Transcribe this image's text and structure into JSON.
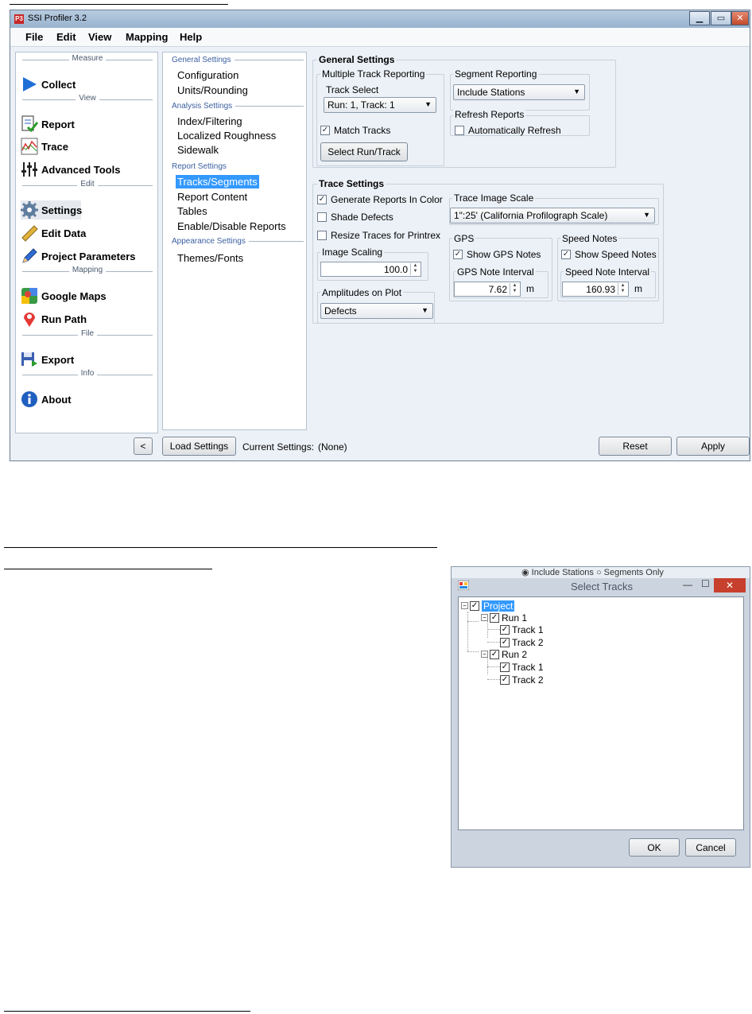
{
  "window": {
    "title": "SSI Profiler 3.2",
    "app_icon_text": "P3",
    "controls": {
      "minimize": "▁",
      "maximize": "▭",
      "close": "✕"
    }
  },
  "menu": [
    "File",
    "Edit",
    "View",
    "Mapping",
    "Help"
  ],
  "nav": {
    "sections": [
      "Measure",
      "View",
      "Edit",
      "Mapping",
      "File",
      "Info"
    ],
    "items": [
      "Collect",
      "Report",
      "Trace",
      "Advanced Tools",
      "Settings",
      "Edit Data",
      "Project Parameters",
      "Google Maps",
      "Run Path",
      "Export",
      "About"
    ]
  },
  "settings_list": {
    "sections": [
      "General Settings",
      "Analysis Settings",
      "Report Settings",
      "Appearance Settings"
    ],
    "items": [
      "Configuration",
      "Units/Rounding",
      "Index/Filtering",
      "Localized Roughness",
      "Sidewalk",
      "Tracks/Segments",
      "Report Content",
      "Tables",
      "Enable/Disable Reports",
      "Themes/Fonts"
    ],
    "selected": "Tracks/Segments"
  },
  "general": {
    "title": "General Settings",
    "multi_track": "Multiple Track Reporting",
    "track_select_label": "Track Select",
    "track_select_value": "Run: 1, Track: 1",
    "match_tracks": "Match Tracks",
    "select_button": "Select Run/Track",
    "segment_label": "Segment Reporting",
    "segment_value": "Include Stations",
    "refresh_label": "Refresh Reports",
    "auto_refresh": "Automatically Refresh"
  },
  "trace": {
    "title": "Trace Settings",
    "gen_color": "Generate Reports In Color",
    "shade_defects": "Shade Defects",
    "resize_printrex": "Resize Traces for Printrex",
    "image_scaling_label": "Image Scaling",
    "image_scaling_value": "100.0",
    "amplitudes_label": "Amplitudes on Plot",
    "amplitudes_value": "Defects",
    "scale_label": "Trace Image Scale",
    "scale_value": "1\":25' (California Profilograph Scale)",
    "gps_label": "GPS",
    "show_gps": "Show GPS Notes",
    "gps_interval_label": "GPS Note Interval",
    "gps_interval_value": "7.62",
    "gps_unit": "m",
    "speed_label": "Speed Notes",
    "show_speed": "Show Speed Notes",
    "speed_interval_label": "Speed Note Interval",
    "speed_interval_value": "160.93",
    "speed_unit": "m"
  },
  "bottom": {
    "collapse": "<",
    "load": "Load Settings",
    "current_label": "Current Settings:",
    "current_value": "(None)",
    "reset": "Reset",
    "apply": "Apply"
  },
  "dialog": {
    "peek_text": "◉ Include Stations    ○ Segments Only",
    "title": "Select Tracks",
    "tree": {
      "root": "Project",
      "runs": [
        {
          "name": "Run 1",
          "tracks": [
            "Track 1",
            "Track 2"
          ]
        },
        {
          "name": "Run 2",
          "tracks": [
            "Track 1",
            "Track 2"
          ]
        }
      ]
    },
    "ok": "OK",
    "cancel": "Cancel",
    "controls": {
      "minimize": "—",
      "maximize": "☐",
      "close": "✕"
    }
  },
  "colors": {
    "selection": "#3399ff",
    "close_button": "#c7402d"
  }
}
